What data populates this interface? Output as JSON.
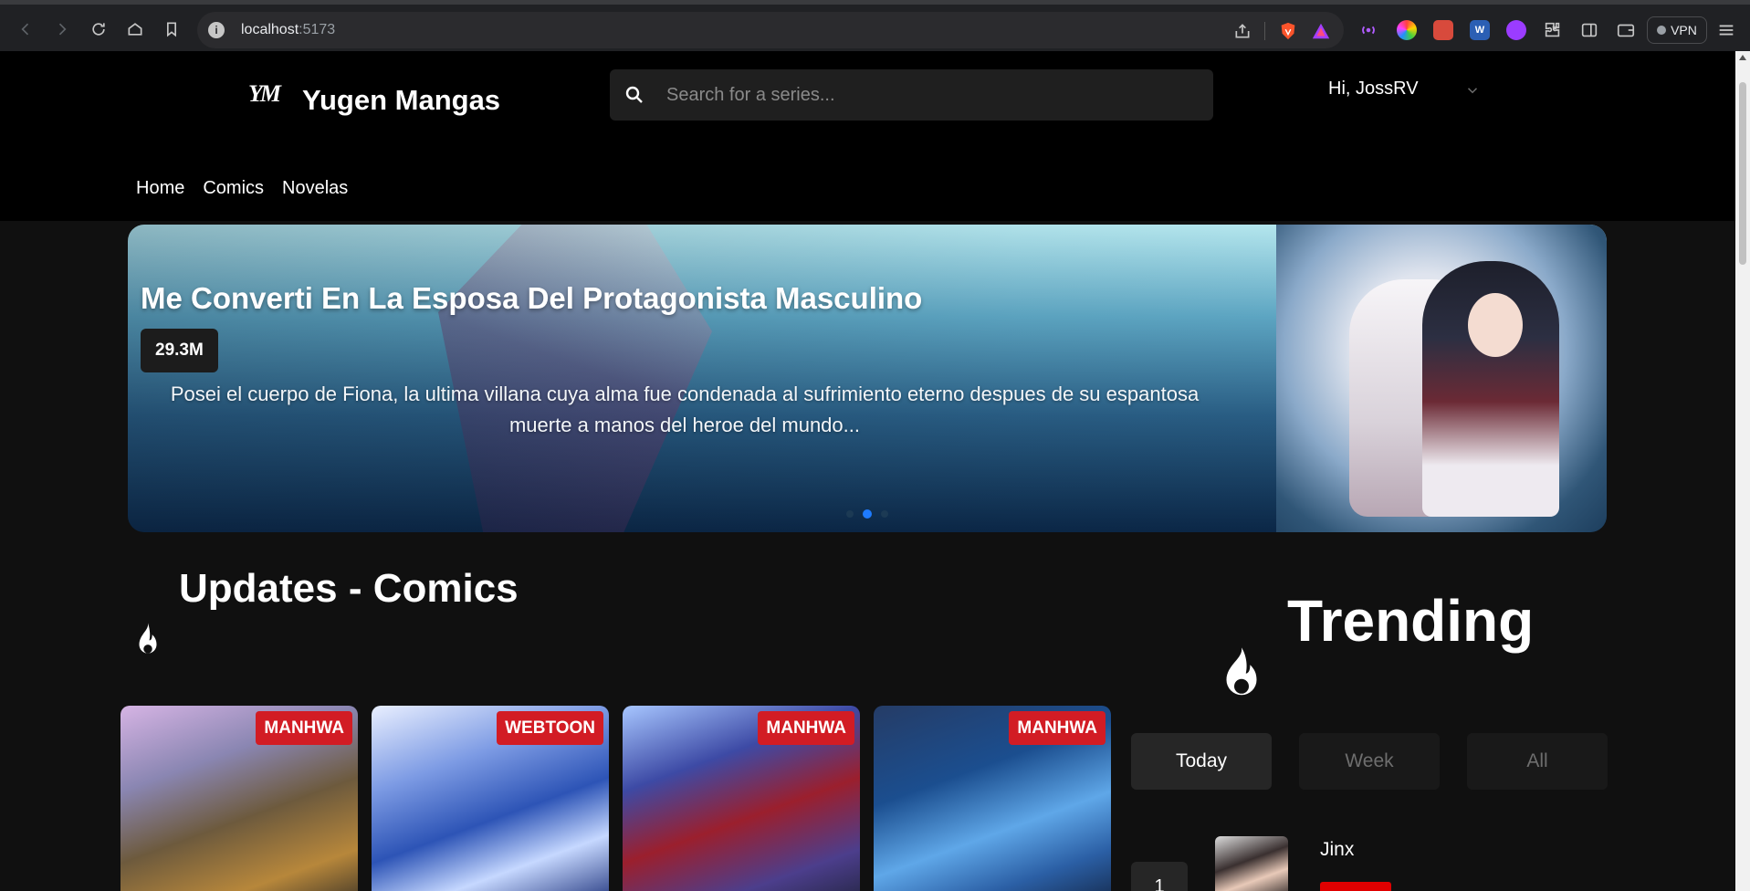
{
  "browser": {
    "url_host": "localhost",
    "url_port": ":5173",
    "vpn_label": "VPN"
  },
  "site": {
    "logo_mark": "YM",
    "name": "Yugen Mangas",
    "search_placeholder": "Search for a series...",
    "greeting": "Hi, JossRV",
    "nav": [
      "Home",
      "Comics",
      "Novelas"
    ]
  },
  "hero": {
    "title": "Me Converti En La Esposa Del Protagonista Masculino",
    "views": "29.3M",
    "description_line1": "Posei el cuerpo de Fiona, la ultima villana cuya alma fue condenada al sufrimiento eterno despues de su espantosa",
    "description_line2": "muerte a manos del heroe del mundo...",
    "slide_count": 3,
    "active_slide": 2
  },
  "updates": {
    "title": "Updates - Comics",
    "cards": [
      {
        "type": "MANHWA"
      },
      {
        "type": "WEBTOON"
      },
      {
        "type": "MANHWA"
      },
      {
        "type": "MANHWA"
      }
    ]
  },
  "trending": {
    "title": "Trending",
    "tabs": [
      "Today",
      "Week",
      "All"
    ],
    "active_tab": "Today",
    "items": [
      {
        "rank": "1",
        "name": "Jinx"
      }
    ]
  },
  "icons": {
    "search": "search-icon",
    "flame": "flame-icon",
    "chevron": "chevron-down-icon"
  },
  "colors": {
    "accent_red": "#d21c24",
    "dot_active": "#1e7bff"
  }
}
